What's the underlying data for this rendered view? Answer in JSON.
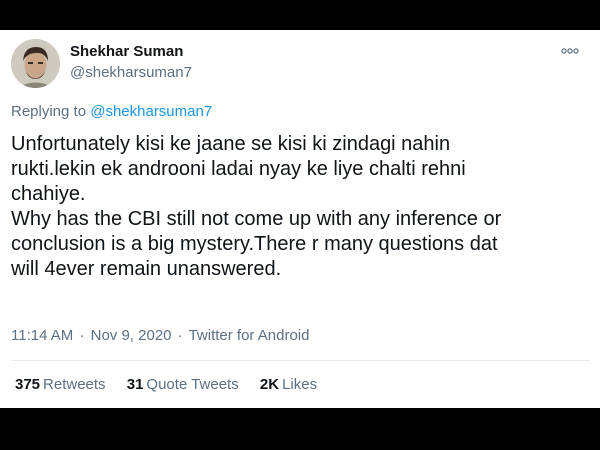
{
  "author": {
    "name": "Shekhar Suman",
    "handle": "@shekharsuman7"
  },
  "more_icon": "more-horizontal-icon",
  "reply": {
    "prefix": "Replying to",
    "handle": "@shekharsuman7"
  },
  "tweet": {
    "lines": [
      "Unfortunately kisi ke jaane se kisi ki zindagi nahin",
      "rukti.lekin ek androoni ladai nyay ke liye chalti rehni",
      "chahiye.",
      "Why has the CBI still not come up with any inference or",
      "conclusion is a big mystery.There r many questions dat",
      "will 4ever remain unanswered."
    ]
  },
  "meta": {
    "time": "11:14 AM",
    "date": "Nov 9, 2020",
    "source": "Twitter for Android",
    "separator": "·"
  },
  "stats": {
    "retweets_count": "375",
    "retweets_label": "Retweets",
    "quotes_count": "31",
    "quotes_label": "Quote Tweets",
    "likes_count": "2K",
    "likes_label": "Likes"
  },
  "colors": {
    "link": "#1b95e0",
    "secondary_text": "#5b7083",
    "primary_text": "#0f1419"
  }
}
